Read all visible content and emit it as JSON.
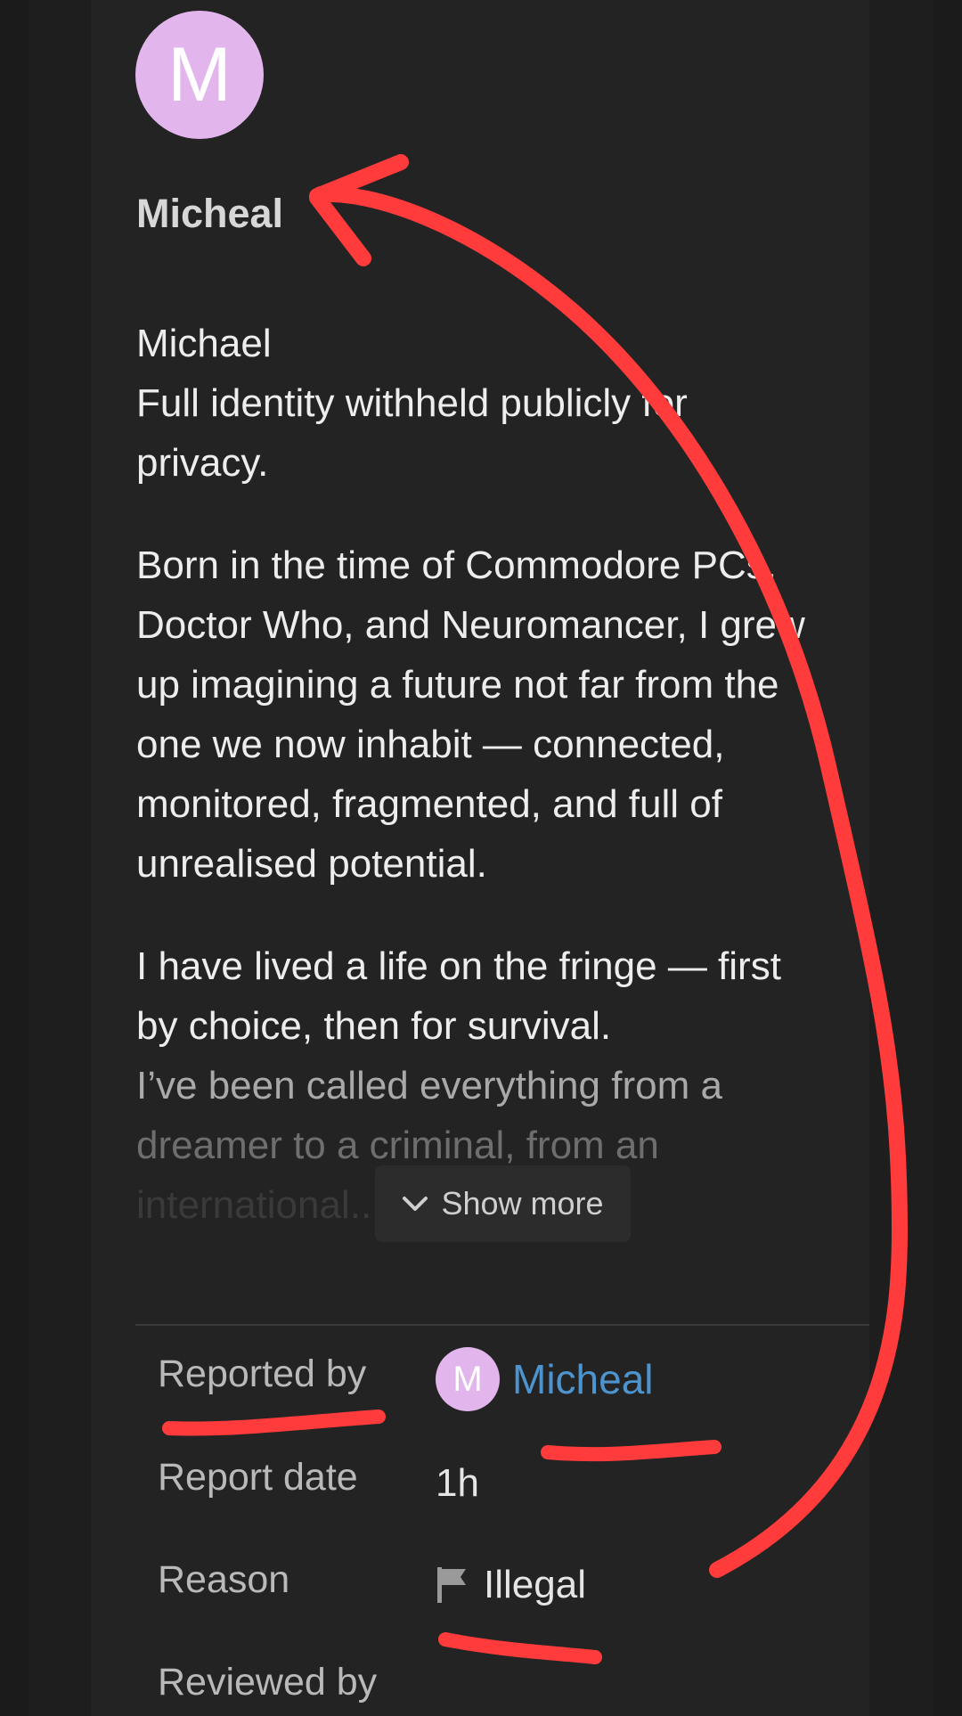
{
  "profile": {
    "avatar_letter": "M",
    "avatar_color": "#e2b6ec",
    "name": "Micheal",
    "bio_lines_p1": [
      "Michael",
      "Full identity withheld publicly for",
      "privacy."
    ],
    "bio_lines_p2": [
      "Born in the time of Commodore PCs,",
      "Doctor Who, and Neuromancer, I grew",
      "up imagining a future not far from the",
      "one we now inhabit — connected,",
      "monitored, fragmented, and full of",
      "unrealised potential."
    ],
    "bio_lines_p3": [
      "I have lived a life on the fringe — first",
      "by choice, then for survival.",
      "I’ve been called everything from a",
      "dreamer to a criminal, from an",
      "international..."
    ],
    "show_more_label": "Show more"
  },
  "report": {
    "reported_by_label": "Reported by",
    "reporter_avatar_letter": "M",
    "reporter_name": "Micheal",
    "report_date_label": "Report date",
    "report_date_value": "1h",
    "reason_label": "Reason",
    "reason_value": "Illegal",
    "reviewed_by_label": "Reviewed by"
  },
  "colors": {
    "background": "#232323",
    "link": "#4d94cf",
    "annotation": "#ff3b3b"
  },
  "icons": [
    "chevron-down-icon",
    "flag-icon"
  ]
}
